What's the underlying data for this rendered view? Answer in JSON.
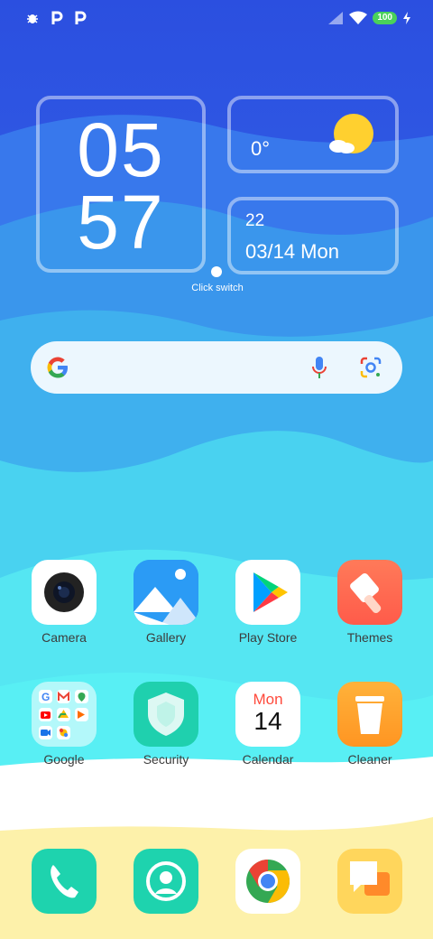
{
  "status_bar": {
    "battery_level": "100",
    "notification_icons": [
      "bug-icon",
      "p-icon",
      "p-icon"
    ],
    "indicators": [
      "signal-icon",
      "wifi-icon",
      "battery-icon",
      "charging-icon"
    ]
  },
  "clock_widget": {
    "hours": "05",
    "minutes": "57"
  },
  "weather_widget": {
    "temperature": "0°",
    "icon": "sun-cloud-icon"
  },
  "date_widget": {
    "line1": "22",
    "line2": "03/14 Mon"
  },
  "widget_switch": {
    "label": "Click switch"
  },
  "search_bar": {
    "icons": [
      "google-icon",
      "mic-icon",
      "lens-icon"
    ]
  },
  "apps": {
    "row1": [
      {
        "label": "Camera",
        "icon": "camera-icon"
      },
      {
        "label": "Gallery",
        "icon": "gallery-icon"
      },
      {
        "label": "Play Store",
        "icon": "play-store-icon"
      },
      {
        "label": "Themes",
        "icon": "themes-icon"
      }
    ],
    "row2": [
      {
        "label": "Google",
        "icon": "google-folder-icon"
      },
      {
        "label": "Security",
        "icon": "security-icon"
      },
      {
        "label": "Calendar",
        "icon": "calendar-icon",
        "day_name": "Mon",
        "day_number": "14"
      },
      {
        "label": "Cleaner",
        "icon": "cleaner-icon"
      }
    ]
  },
  "dock": [
    "phone-icon",
    "contacts-icon",
    "chrome-icon",
    "messages-icon"
  ],
  "colors": {
    "sky_top": "#2f56e0",
    "sea": "#4ce4f2",
    "sand": "#fdf0a8",
    "accent_green": "#1ecfae"
  }
}
